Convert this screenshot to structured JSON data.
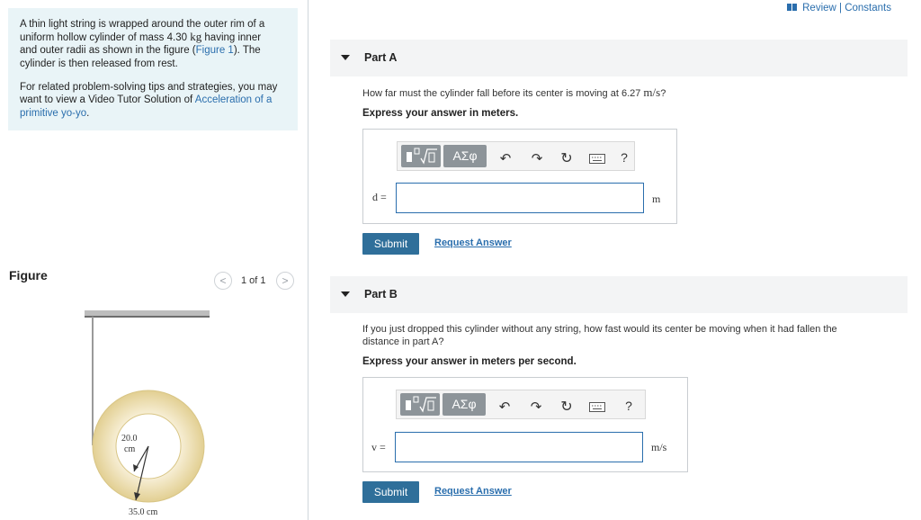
{
  "problem": {
    "text_lines_1": [
      "A thin light string is wrapped around the outer rim of a",
      "uniform hollow cylinder of mass 4.30 ",
      "and outer radii as shown in the figure (",
      "cylinder is then released from rest."
    ],
    "mass_unit": "kg",
    "having_inner": " having inner",
    "figure_link": "Figure 1",
    "after_link": "). The",
    "text_lines_2": [
      "For related problem-solving tips and strategies, you may",
      "want to view a Video Tutor Solution of "
    ],
    "video_link_1": "Acceleration of a",
    "video_link_2": "primitive yo-yo",
    "video_period": "."
  },
  "header": {
    "review_link": "Review | Constants"
  },
  "figure": {
    "title": "Figure",
    "pager": "1 of 1",
    "prev": "<",
    "next": ">",
    "inner_label_1": "20.0",
    "inner_label_2": "cm",
    "outer_label": "35.0 cm",
    "ring_color": "#e9d9a6"
  },
  "part_a": {
    "label": "Part A",
    "question_prefix": "How far must the cylinder fall before its center is moving at 6.27 ",
    "question_unit": "m/s",
    "question_suffix": "?",
    "instruction": "Express your answer in meters.",
    "variable": "d =",
    "unit": "m",
    "input_value": "",
    "submit": "Submit",
    "request": "Request Answer"
  },
  "part_b": {
    "label": "Part B",
    "question_line1": "If you just dropped this cylinder without any string, how fast would its center be moving when it had fallen the",
    "question_line2": "distance in part A?",
    "instruction": "Express your answer in meters per second.",
    "variable": "v =",
    "unit": "m/s",
    "input_value": "",
    "submit": "Submit",
    "request": "Request Answer"
  },
  "toolbar": {
    "templates_icon": "templates-icon",
    "greek_label": "ΑΣφ",
    "undo_glyph": "↶",
    "redo_glyph": "↷",
    "reset_glyph": "↻",
    "keyboard_icon": "keyboard-icon",
    "help_glyph": "?"
  }
}
